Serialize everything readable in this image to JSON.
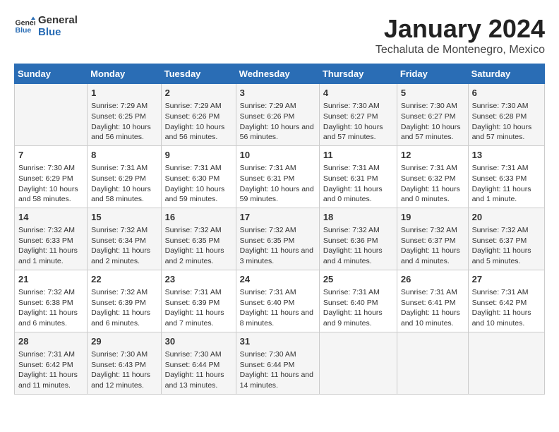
{
  "logo": {
    "line1": "General",
    "line2": "Blue"
  },
  "title": "January 2024",
  "subtitle": "Techaluta de Montenegro, Mexico",
  "days_of_week": [
    "Sunday",
    "Monday",
    "Tuesday",
    "Wednesday",
    "Thursday",
    "Friday",
    "Saturday"
  ],
  "weeks": [
    [
      {
        "day": "",
        "content": ""
      },
      {
        "day": "1",
        "content": "Sunrise: 7:29 AM\nSunset: 6:25 PM\nDaylight: 10 hours and 56 minutes."
      },
      {
        "day": "2",
        "content": "Sunrise: 7:29 AM\nSunset: 6:26 PM\nDaylight: 10 hours and 56 minutes."
      },
      {
        "day": "3",
        "content": "Sunrise: 7:29 AM\nSunset: 6:26 PM\nDaylight: 10 hours and 56 minutes."
      },
      {
        "day": "4",
        "content": "Sunrise: 7:30 AM\nSunset: 6:27 PM\nDaylight: 10 hours and 57 minutes."
      },
      {
        "day": "5",
        "content": "Sunrise: 7:30 AM\nSunset: 6:27 PM\nDaylight: 10 hours and 57 minutes."
      },
      {
        "day": "6",
        "content": "Sunrise: 7:30 AM\nSunset: 6:28 PM\nDaylight: 10 hours and 57 minutes."
      }
    ],
    [
      {
        "day": "7",
        "content": "Sunrise: 7:30 AM\nSunset: 6:29 PM\nDaylight: 10 hours and 58 minutes."
      },
      {
        "day": "8",
        "content": "Sunrise: 7:31 AM\nSunset: 6:29 PM\nDaylight: 10 hours and 58 minutes."
      },
      {
        "day": "9",
        "content": "Sunrise: 7:31 AM\nSunset: 6:30 PM\nDaylight: 10 hours and 59 minutes."
      },
      {
        "day": "10",
        "content": "Sunrise: 7:31 AM\nSunset: 6:31 PM\nDaylight: 10 hours and 59 minutes."
      },
      {
        "day": "11",
        "content": "Sunrise: 7:31 AM\nSunset: 6:31 PM\nDaylight: 11 hours and 0 minutes."
      },
      {
        "day": "12",
        "content": "Sunrise: 7:31 AM\nSunset: 6:32 PM\nDaylight: 11 hours and 0 minutes."
      },
      {
        "day": "13",
        "content": "Sunrise: 7:31 AM\nSunset: 6:33 PM\nDaylight: 11 hours and 1 minute."
      }
    ],
    [
      {
        "day": "14",
        "content": "Sunrise: 7:32 AM\nSunset: 6:33 PM\nDaylight: 11 hours and 1 minute."
      },
      {
        "day": "15",
        "content": "Sunrise: 7:32 AM\nSunset: 6:34 PM\nDaylight: 11 hours and 2 minutes."
      },
      {
        "day": "16",
        "content": "Sunrise: 7:32 AM\nSunset: 6:35 PM\nDaylight: 11 hours and 2 minutes."
      },
      {
        "day": "17",
        "content": "Sunrise: 7:32 AM\nSunset: 6:35 PM\nDaylight: 11 hours and 3 minutes."
      },
      {
        "day": "18",
        "content": "Sunrise: 7:32 AM\nSunset: 6:36 PM\nDaylight: 11 hours and 4 minutes."
      },
      {
        "day": "19",
        "content": "Sunrise: 7:32 AM\nSunset: 6:37 PM\nDaylight: 11 hours and 4 minutes."
      },
      {
        "day": "20",
        "content": "Sunrise: 7:32 AM\nSunset: 6:37 PM\nDaylight: 11 hours and 5 minutes."
      }
    ],
    [
      {
        "day": "21",
        "content": "Sunrise: 7:32 AM\nSunset: 6:38 PM\nDaylight: 11 hours and 6 minutes."
      },
      {
        "day": "22",
        "content": "Sunrise: 7:32 AM\nSunset: 6:39 PM\nDaylight: 11 hours and 6 minutes."
      },
      {
        "day": "23",
        "content": "Sunrise: 7:31 AM\nSunset: 6:39 PM\nDaylight: 11 hours and 7 minutes."
      },
      {
        "day": "24",
        "content": "Sunrise: 7:31 AM\nSunset: 6:40 PM\nDaylight: 11 hours and 8 minutes."
      },
      {
        "day": "25",
        "content": "Sunrise: 7:31 AM\nSunset: 6:40 PM\nDaylight: 11 hours and 9 minutes."
      },
      {
        "day": "26",
        "content": "Sunrise: 7:31 AM\nSunset: 6:41 PM\nDaylight: 11 hours and 10 minutes."
      },
      {
        "day": "27",
        "content": "Sunrise: 7:31 AM\nSunset: 6:42 PM\nDaylight: 11 hours and 10 minutes."
      }
    ],
    [
      {
        "day": "28",
        "content": "Sunrise: 7:31 AM\nSunset: 6:42 PM\nDaylight: 11 hours and 11 minutes."
      },
      {
        "day": "29",
        "content": "Sunrise: 7:30 AM\nSunset: 6:43 PM\nDaylight: 11 hours and 12 minutes."
      },
      {
        "day": "30",
        "content": "Sunrise: 7:30 AM\nSunset: 6:44 PM\nDaylight: 11 hours and 13 minutes."
      },
      {
        "day": "31",
        "content": "Sunrise: 7:30 AM\nSunset: 6:44 PM\nDaylight: 11 hours and 14 minutes."
      },
      {
        "day": "",
        "content": ""
      },
      {
        "day": "",
        "content": ""
      },
      {
        "day": "",
        "content": ""
      }
    ]
  ]
}
